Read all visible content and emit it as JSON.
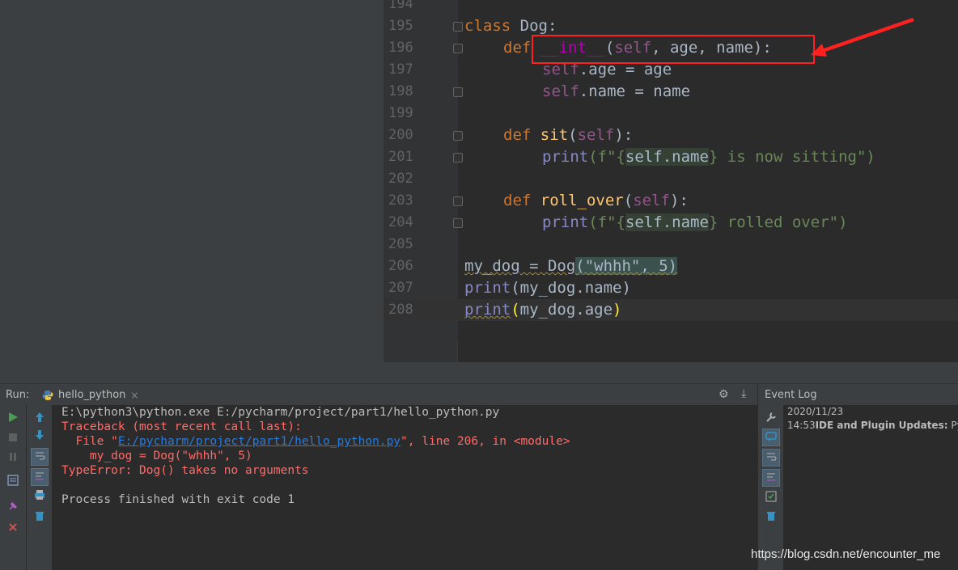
{
  "editor": {
    "lines": [
      {
        "num": "194"
      },
      {
        "num": "195"
      },
      {
        "num": "196"
      },
      {
        "num": "197"
      },
      {
        "num": "198"
      },
      {
        "num": "199"
      },
      {
        "num": "200"
      },
      {
        "num": "201"
      },
      {
        "num": "202"
      },
      {
        "num": "203"
      },
      {
        "num": "204"
      },
      {
        "num": "205"
      },
      {
        "num": "206"
      },
      {
        "num": "207"
      },
      {
        "num": "208"
      }
    ],
    "code": {
      "l195_kw": "class",
      "l195_name": " Dog:",
      "l196_kw": "def",
      "l196_fn": "__int__",
      "l196_open": "(",
      "l196_self": "self",
      "l196_rest": ", age, name):",
      "l197_self": "self",
      "l197_rest": ".age = age",
      "l198_self": "self",
      "l198_rest": ".name = name",
      "l200_kw": "def",
      "l200_fn": "sit",
      "l200_open": "(",
      "l200_self": "self",
      "l200_close": "):",
      "l201_print": "print",
      "l201_a": "(f\"{",
      "l201_b": "self.name",
      "l201_c": "} is now sitting\")",
      "l203_kw": "def",
      "l203_fn": "roll_over",
      "l203_open": "(",
      "l203_self": "self",
      "l203_close": "):",
      "l204_print": "print",
      "l204_a": "(f\"{",
      "l204_b": "self.name",
      "l204_c": "} rolled over\")",
      "l206_a": "my_dog",
      "l206_b": " = Dog",
      "l206_c": "(\"whhh\", 5)",
      "l207_print": "print",
      "l207_rest": "(my_dog.name)",
      "l208_print": "print",
      "l208_open": "(",
      "l208_mid": "my_dog.age",
      "l208_close": ")"
    }
  },
  "run_panel": {
    "title": "Run:",
    "tab_label": "hello_python",
    "tab_close": "×",
    "settings_icon": "⚙",
    "minimize_icon": "⤓",
    "console": {
      "cmd": "E:\\python3\\python.exe E:/pycharm/project/part1/hello_python.py",
      "traceback": "Traceback (most recent call last):",
      "file_prefix": "  File \"",
      "file_link": "E:/pycharm/project/part1/hello_python.py",
      "file_suffix": "\", line 206, in <module>",
      "code_line": "    my_dog = Dog(\"whhh\", 5)",
      "error": "TypeError: Dog() takes no arguments",
      "exit": "Process finished with exit code 1"
    }
  },
  "event_log": {
    "title": "Event Log",
    "date": "2020/11/23",
    "time": "14:53",
    "message_bold": "IDE and Plugin Updates:",
    "message_rest": " PyCh"
  },
  "watermark": "https://blog.csdn.net/encounter_me",
  "colors": {
    "keyword": "#cc7832",
    "function": "#ffc66d",
    "self": "#94558d",
    "string": "#6a8759",
    "error": "#ff6b68",
    "annotation_red": "#ff2020"
  }
}
